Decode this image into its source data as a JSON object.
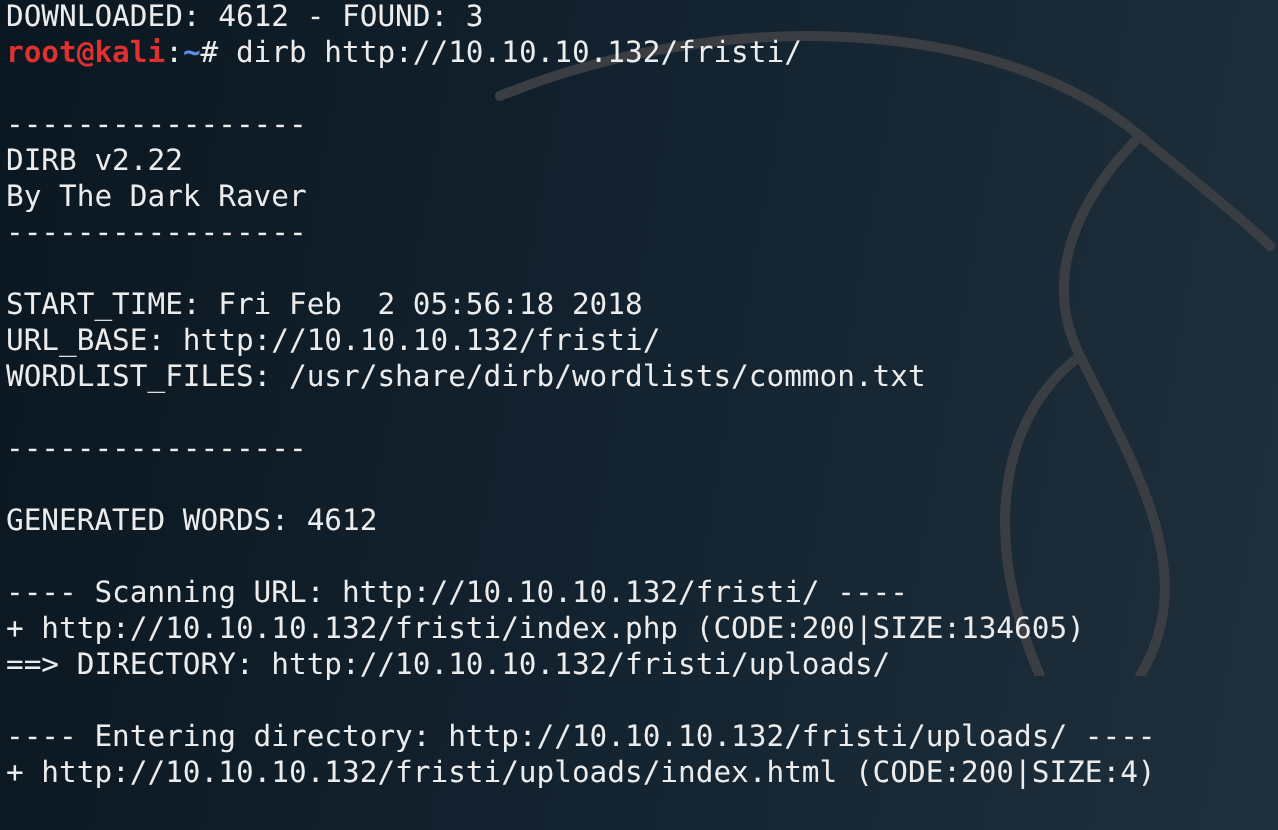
{
  "terminal": {
    "lines": [
      {
        "kind": "output",
        "text": "DOWNLOADED: 4612 - FOUND: 3"
      },
      {
        "kind": "prompt",
        "user": "root@kali",
        "separator": ":",
        "path": "~",
        "symbol": "#",
        "command": "dirb http://10.10.10.132/fristi/"
      },
      {
        "kind": "blank"
      },
      {
        "kind": "output",
        "text": "-----------------"
      },
      {
        "kind": "output",
        "text": "DIRB v2.22"
      },
      {
        "kind": "output",
        "text": "By The Dark Raver"
      },
      {
        "kind": "output",
        "text": "-----------------"
      },
      {
        "kind": "blank"
      },
      {
        "kind": "output",
        "text": "START_TIME: Fri Feb  2 05:56:18 2018"
      },
      {
        "kind": "output",
        "text": "URL_BASE: http://10.10.10.132/fristi/"
      },
      {
        "kind": "output",
        "text": "WORDLIST_FILES: /usr/share/dirb/wordlists/common.txt"
      },
      {
        "kind": "blank"
      },
      {
        "kind": "output",
        "text": "-----------------"
      },
      {
        "kind": "blank"
      },
      {
        "kind": "output",
        "text": "GENERATED WORDS: 4612"
      },
      {
        "kind": "blank"
      },
      {
        "kind": "output",
        "text": "---- Scanning URL: http://10.10.10.132/fristi/ ----"
      },
      {
        "kind": "output",
        "text": "+ http://10.10.10.132/fristi/index.php (CODE:200|SIZE:134605)"
      },
      {
        "kind": "output",
        "text": "==> DIRECTORY: http://10.10.10.132/fristi/uploads/"
      },
      {
        "kind": "blank"
      },
      {
        "kind": "output",
        "text": "---- Entering directory: http://10.10.10.132/fristi/uploads/ ----"
      },
      {
        "kind": "output",
        "text": "+ http://10.10.10.132/fristi/uploads/index.html (CODE:200|SIZE:4)"
      }
    ]
  }
}
